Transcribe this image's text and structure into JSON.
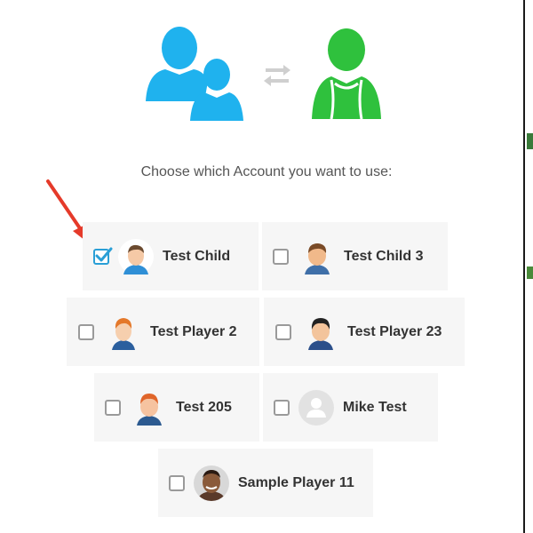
{
  "prompt": "Choose which Account you want to use:",
  "hero": {
    "left_icon": "family-users-icon",
    "middle_icon": "swap-arrows-icon",
    "right_icon": "player-jersey-icon",
    "blue": "#1fb2ee",
    "green": "#2fc13d",
    "grey": "#cfcfcf"
  },
  "accounts": [
    {
      "name": "Test Child",
      "checked": true,
      "avatar": "boy-brown-hair-avatar"
    },
    {
      "name": "Test Child 3",
      "checked": false,
      "avatar": "boy-brown-hair-avatar"
    },
    {
      "name": "Test Player 2",
      "checked": false,
      "avatar": "boy-orange-hair-avatar"
    },
    {
      "name": "Test Player 23",
      "checked": false,
      "avatar": "boy-black-hair-avatar"
    },
    {
      "name": "Test 205",
      "checked": false,
      "avatar": "boy-orange-hair-avatar"
    },
    {
      "name": "Mike Test",
      "checked": false,
      "avatar": "default-user-avatar"
    },
    {
      "name": "Sample Player 11",
      "checked": false,
      "avatar": "photo-avatar"
    }
  ],
  "colors": {
    "checkbox_checked": "#2a9fd6",
    "annotation_arrow": "#e53a2a",
    "card_bg": "#f6f6f6"
  }
}
